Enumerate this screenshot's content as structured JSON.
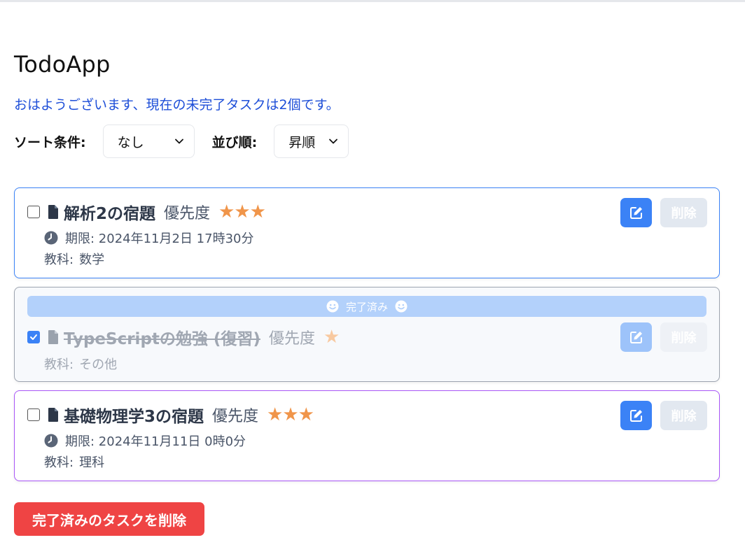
{
  "app": {
    "title": "TodoApp",
    "greeting": "おはようございます、現在の未完了タスクは2個です。"
  },
  "controls": {
    "sort_label": "ソート条件:",
    "sort_value": "なし",
    "order_label": "並び順:",
    "order_value": "昇順"
  },
  "tasks": [
    {
      "title": "解析2の宿題",
      "priority_label": "優先度",
      "stars": "★★★",
      "priority": 3,
      "completed": false,
      "due": "期限: 2024年11月2日 17時30分",
      "subject_label": "教科:",
      "subject": "数学",
      "delete_label": "削除",
      "border_color": "#3b82f6"
    },
    {
      "title": "TypeScriptの勉強 (復習)",
      "priority_label": "優先度",
      "stars": "★",
      "priority": 1,
      "completed": true,
      "done_label": "完了済み",
      "subject_label": "教科:",
      "subject": "その他",
      "delete_label": "削除",
      "border_color": "#9ca3af"
    },
    {
      "title": "基礎物理学3の宿題",
      "priority_label": "優先度",
      "stars": "★★★",
      "priority": 3,
      "completed": false,
      "due": "期限: 2024年11月11日 0時0分",
      "subject_label": "教科:",
      "subject": "理科",
      "delete_label": "削除",
      "border_color": "#a855f7"
    }
  ],
  "footer": {
    "clear_completed_label": "完了済みのタスクを削除"
  },
  "icons": {
    "document": "document-icon",
    "clock": "clock-icon",
    "edit": "pencil-icon",
    "smile": "smile-icon",
    "chevron": "chevron-down-icon"
  },
  "colors": {
    "accent": "#3b82f6",
    "danger": "#ef4444",
    "star": "#f0954a",
    "greeting": "#1d4ed8"
  }
}
